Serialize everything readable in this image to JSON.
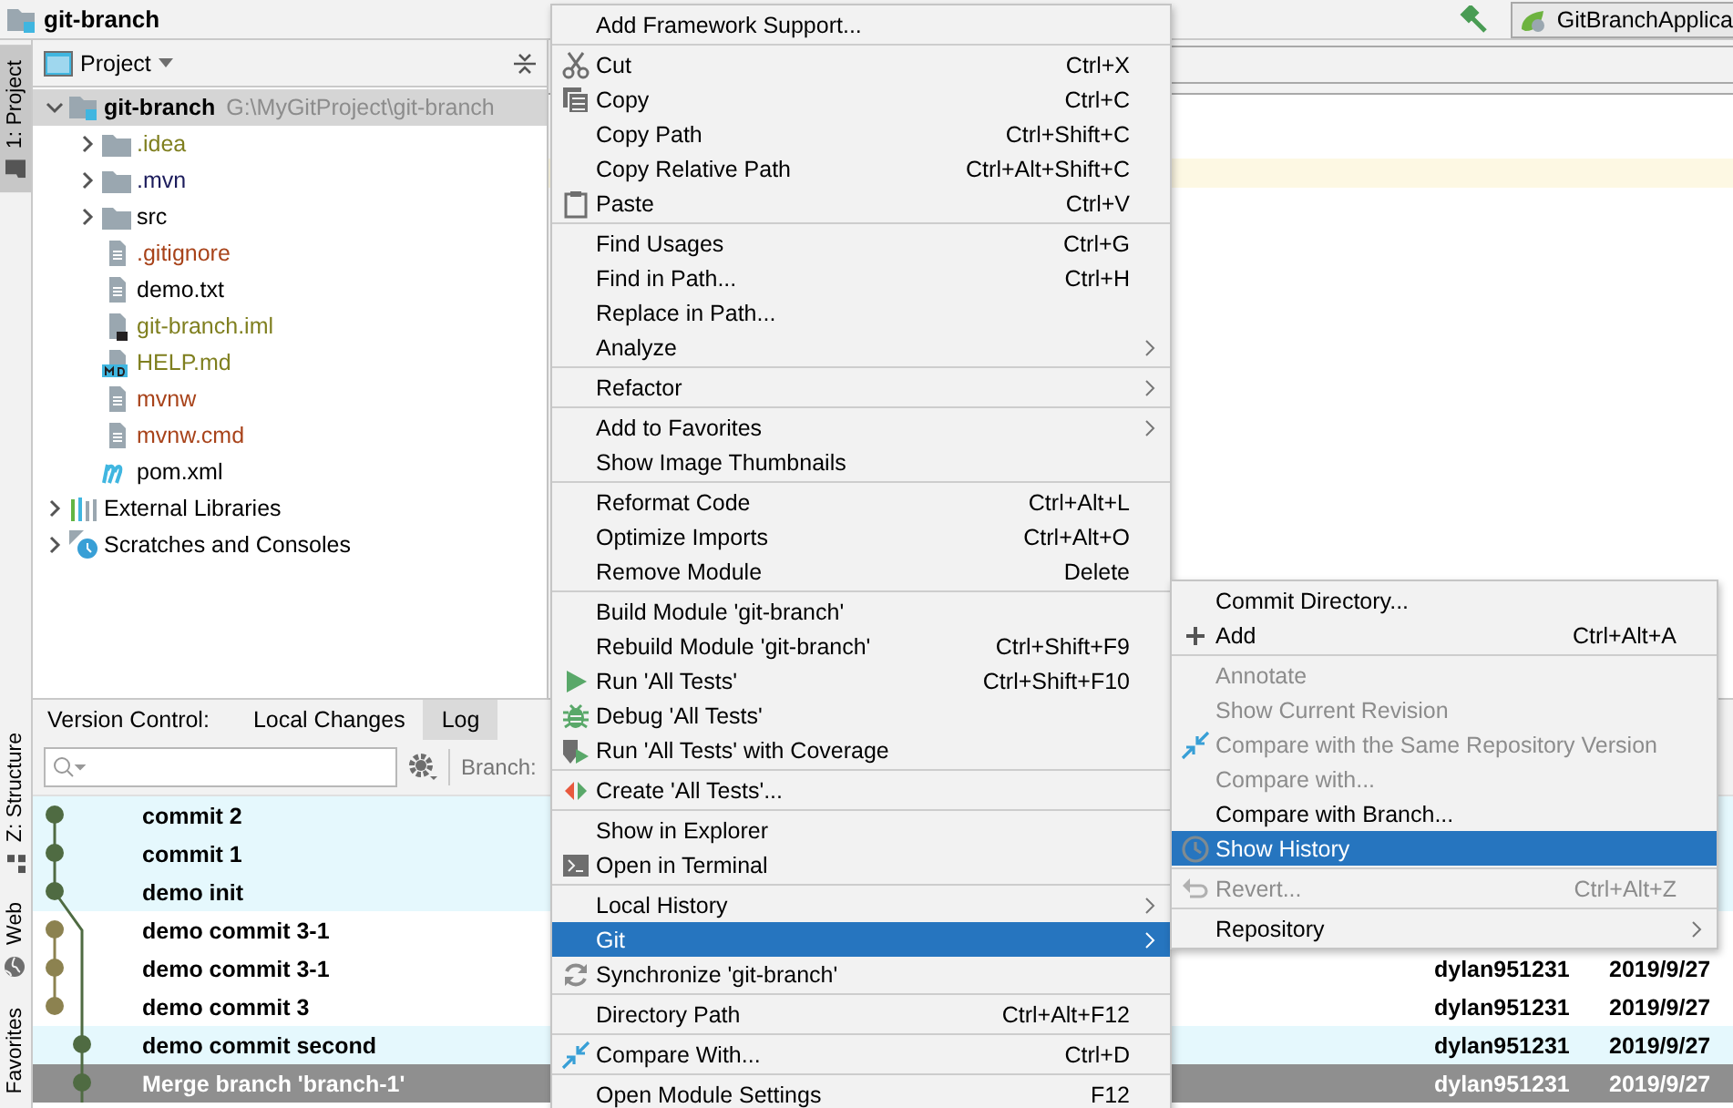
{
  "window": {
    "title": "git-branch"
  },
  "toolbar": {
    "run_configuration": "GitBranchApplica"
  },
  "tool_strip": {
    "tabs": [
      {
        "label": "1: Project",
        "kind": "project",
        "selected": true
      },
      {
        "label": "Z: Structure",
        "kind": "structure",
        "selected": false
      },
      {
        "label": "Web",
        "kind": "web",
        "selected": false
      },
      {
        "label": "Favorites",
        "kind": "favorites",
        "selected": false
      }
    ]
  },
  "project_panel": {
    "title": "Project",
    "tree": [
      {
        "label": "git-branch",
        "path": "G:\\MyGitProject\\git-branch",
        "kind": "module",
        "expanded": true,
        "selected": true,
        "color": "#000000",
        "children": [
          {
            "label": ".idea",
            "kind": "folder",
            "expanded": false,
            "selected": false,
            "color": "#7f7f1f"
          },
          {
            "label": ".mvn",
            "kind": "folder",
            "expanded": false,
            "selected": false,
            "color": "#1c1c5c"
          },
          {
            "label": "src",
            "kind": "folder",
            "expanded": false,
            "selected": false,
            "color": "#000000"
          },
          {
            "label": ".gitignore",
            "kind": "file",
            "selected": false,
            "color": "#a8431a"
          },
          {
            "label": "demo.txt",
            "kind": "file",
            "selected": false,
            "color": "#000000"
          },
          {
            "label": "git-branch.iml",
            "kind": "iml",
            "selected": false,
            "color": "#7f7f1f"
          },
          {
            "label": "HELP.md",
            "kind": "markdown",
            "selected": false,
            "color": "#7f7f1f"
          },
          {
            "label": "mvnw",
            "kind": "file",
            "selected": false,
            "color": "#a8431a"
          },
          {
            "label": "mvnw.cmd",
            "kind": "file",
            "selected": false,
            "color": "#a8431a"
          },
          {
            "label": "pom.xml",
            "kind": "maven",
            "selected": false,
            "color": "#000000"
          }
        ]
      },
      {
        "label": "External Libraries",
        "kind": "libraries",
        "expanded": false,
        "selected": false,
        "color": "#000000"
      },
      {
        "label": "Scratches and Consoles",
        "kind": "scratches",
        "expanded": false,
        "selected": false,
        "color": "#000000"
      }
    ]
  },
  "version_control": {
    "title": "Version Control:",
    "tabs": [
      {
        "label": "Local Changes",
        "selected": false
      },
      {
        "label": "Log",
        "selected": true
      }
    ],
    "branch_label": "Branch:",
    "rows": [
      {
        "message": "commit 2",
        "color": "#4f6b42",
        "kind": "left",
        "highlighted": true,
        "selected": false
      },
      {
        "message": "commit 1",
        "color": "#4f6b42",
        "kind": "left",
        "highlighted": true,
        "selected": false
      },
      {
        "message": "demo init",
        "color": "#4f6b42",
        "kind": "left",
        "highlighted": true,
        "selected": false
      },
      {
        "message": "demo commit 3-1",
        "color": "#8c8250",
        "kind": "left",
        "highlighted": false,
        "selected": false
      },
      {
        "message": "demo commit 3-1",
        "author": "dylan951231",
        "date": "2019/9/27",
        "color": "#8c8250",
        "kind": "left",
        "highlighted": false,
        "selected": false
      },
      {
        "message": "demo commit 3",
        "author": "dylan951231",
        "date": "2019/9/27",
        "color": "#8c8250",
        "kind": "left",
        "highlighted": false,
        "selected": false
      },
      {
        "message": "demo commit second",
        "author": "dylan951231",
        "date": "2019/9/27",
        "color": "#4f6b42",
        "kind": "right",
        "highlighted": true,
        "selected": false
      },
      {
        "message": "Merge branch 'branch-1'",
        "author": "dylan951231",
        "date": "2019/9/27",
        "color": "#4f6b42",
        "kind": "right",
        "highlighted": false,
        "selected": true
      }
    ]
  },
  "context_menu": {
    "groups": [
      [
        {
          "label": "Add Framework Support...",
          "kind": "plain",
          "has_submenu": false,
          "selected": false
        }
      ],
      [
        {
          "label": "Cut",
          "shortcut": "Ctrl+X",
          "kind": "cut",
          "has_submenu": false,
          "selected": false
        },
        {
          "label": "Copy",
          "shortcut": "Ctrl+C",
          "kind": "copy",
          "has_submenu": false,
          "selected": false
        },
        {
          "label": "Copy Path",
          "shortcut": "Ctrl+Shift+C",
          "kind": "plain",
          "has_submenu": false,
          "selected": false
        },
        {
          "label": "Copy Relative Path",
          "shortcut": "Ctrl+Alt+Shift+C",
          "kind": "plain",
          "has_submenu": false,
          "selected": false
        },
        {
          "label": "Paste",
          "shortcut": "Ctrl+V",
          "kind": "paste",
          "has_submenu": false,
          "selected": false
        }
      ],
      [
        {
          "label": "Find Usages",
          "shortcut": "Ctrl+G",
          "kind": "plain",
          "has_submenu": false,
          "selected": false
        },
        {
          "label": "Find in Path...",
          "shortcut": "Ctrl+H",
          "kind": "plain",
          "has_submenu": false,
          "selected": false
        },
        {
          "label": "Replace in Path...",
          "kind": "plain",
          "has_submenu": false,
          "selected": false
        },
        {
          "label": "Analyze",
          "kind": "plain",
          "has_submenu": true,
          "selected": false
        }
      ],
      [
        {
          "label": "Refactor",
          "kind": "plain",
          "has_submenu": true,
          "selected": false
        }
      ],
      [
        {
          "label": "Add to Favorites",
          "kind": "plain",
          "has_submenu": true,
          "selected": false
        },
        {
          "label": "Show Image Thumbnails",
          "kind": "plain",
          "has_submenu": false,
          "selected": false
        }
      ],
      [
        {
          "label": "Reformat Code",
          "shortcut": "Ctrl+Alt+L",
          "kind": "plain",
          "has_submenu": false,
          "selected": false
        },
        {
          "label": "Optimize Imports",
          "shortcut": "Ctrl+Alt+O",
          "kind": "plain",
          "has_submenu": false,
          "selected": false
        },
        {
          "label": "Remove Module",
          "shortcut": "Delete",
          "kind": "plain",
          "has_submenu": false,
          "selected": false
        }
      ],
      [
        {
          "label": "Build Module 'git-branch'",
          "kind": "plain",
          "has_submenu": false,
          "selected": false
        },
        {
          "label": "Rebuild Module 'git-branch'",
          "shortcut": "Ctrl+Shift+F9",
          "kind": "plain",
          "has_submenu": false,
          "selected": false
        },
        {
          "label": "Run 'All Tests'",
          "shortcut": "Ctrl+Shift+F10",
          "kind": "run",
          "has_submenu": false,
          "selected": false
        },
        {
          "label": "Debug 'All Tests'",
          "kind": "debug",
          "has_submenu": false,
          "selected": false
        },
        {
          "label": "Run 'All Tests' with Coverage",
          "kind": "coverage",
          "has_submenu": false,
          "selected": false
        }
      ],
      [
        {
          "label": "Create 'All Tests'...",
          "kind": "create",
          "has_submenu": false,
          "selected": false
        }
      ],
      [
        {
          "label": "Show in Explorer",
          "kind": "plain",
          "has_submenu": false,
          "selected": false
        },
        {
          "label": "Open in Terminal",
          "kind": "terminal",
          "has_submenu": false,
          "selected": false
        }
      ],
      [
        {
          "label": "Local History",
          "kind": "plain",
          "has_submenu": true,
          "selected": false
        },
        {
          "label": "Git",
          "kind": "plain",
          "has_submenu": true,
          "selected": true
        },
        {
          "label": "Synchronize 'git-branch'",
          "kind": "sync",
          "has_submenu": false,
          "selected": false
        }
      ],
      [
        {
          "label": "Directory Path",
          "shortcut": "Ctrl+Alt+F12",
          "kind": "plain",
          "has_submenu": false,
          "selected": false
        }
      ],
      [
        {
          "label": "Compare With...",
          "shortcut": "Ctrl+D",
          "kind": "compare",
          "has_submenu": false,
          "selected": false
        }
      ],
      [
        {
          "label": "Open Module Settings",
          "shortcut": "F12",
          "kind": "plain",
          "has_submenu": false,
          "selected": false
        }
      ]
    ]
  },
  "git_submenu": {
    "groups": [
      [
        {
          "label": "Commit Directory...",
          "kind": "plain",
          "has_submenu": false,
          "disabled": false,
          "selected": false
        },
        {
          "label": "Add",
          "shortcut": "Ctrl+Alt+A",
          "kind": "add",
          "has_submenu": false,
          "disabled": false,
          "selected": false
        }
      ],
      [
        {
          "label": "Annotate",
          "kind": "plain",
          "has_submenu": false,
          "disabled": true,
          "selected": false
        },
        {
          "label": "Show Current Revision",
          "kind": "plain",
          "has_submenu": false,
          "disabled": true,
          "selected": false
        },
        {
          "label": "Compare with the Same Repository Version",
          "kind": "compare",
          "has_submenu": false,
          "disabled": true,
          "selected": false
        },
        {
          "label": "Compare with...",
          "kind": "plain",
          "has_submenu": false,
          "disabled": true,
          "selected": false
        },
        {
          "label": "Compare with Branch...",
          "kind": "plain",
          "has_submenu": false,
          "disabled": false,
          "selected": false
        },
        {
          "label": "Show History",
          "kind": "history",
          "has_submenu": false,
          "disabled": false,
          "selected": true
        }
      ],
      [
        {
          "label": "Revert...",
          "shortcut": "Ctrl+Alt+Z",
          "kind": "revert",
          "has_submenu": false,
          "disabled": true,
          "selected": false
        }
      ],
      [
        {
          "label": "Repository",
          "kind": "plain",
          "has_submenu": true,
          "disabled": false,
          "selected": false
        }
      ]
    ]
  }
}
